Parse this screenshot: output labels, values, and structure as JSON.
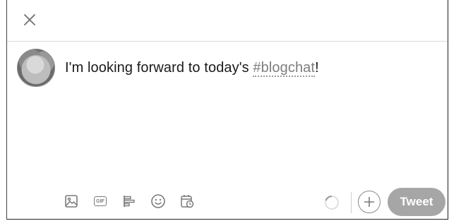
{
  "header": {
    "close_icon": "close-icon"
  },
  "compose": {
    "avatar_icon": "user-avatar",
    "text_before": "I'm looking forward to today's ",
    "hashtag": "#blogchat",
    "text_after": "!"
  },
  "toolbar": {
    "icons": [
      "image-icon",
      "gif-icon",
      "poll-icon",
      "emoji-icon",
      "schedule-icon"
    ],
    "gif_label": "GIF",
    "progress_icon": "character-count-ring",
    "add_icon": "plus-icon",
    "tweet_label": "Tweet"
  },
  "colors": {
    "tweet_button_bg": "#a6a6a6",
    "hashtag": "#7d7d7d"
  }
}
